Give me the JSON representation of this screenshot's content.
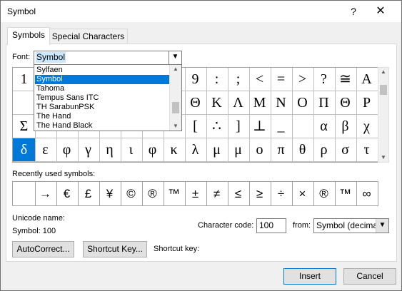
{
  "window": {
    "title": "Symbol",
    "help": "?",
    "close": "✕"
  },
  "tabs": [
    {
      "label": "Symbols"
    },
    {
      "label": "Special Characters"
    }
  ],
  "font": {
    "label": "Font:",
    "value": "Symbol",
    "dropdown_icon": "chevron-down-icon"
  },
  "font_list": [
    "Sylfaen",
    "Symbol",
    "Tahoma",
    "Tempus Sans ITC",
    "TH SarabunPSK",
    "The Hand",
    "The Hand Black"
  ],
  "grid": {
    "rows": [
      [
        "1",
        "",
        "",
        "",
        "",
        "",
        "",
        "",
        "9",
        ":",
        ";",
        "<",
        "=",
        ">",
        "?",
        "≅",
        "Α"
      ],
      [
        "",
        "",
        "",
        "",
        "",
        "",
        "",
        "",
        "Θ",
        "Κ",
        "Λ",
        "Μ",
        "Ν",
        "Ο",
        "Π",
        "Θ",
        "Ρ"
      ],
      [
        "Σ",
        "",
        "",
        "",
        "",
        "",
        "",
        "",
        "[",
        "∴",
        "]",
        "⊥",
        "_",
        "",
        "α",
        "β",
        "χ"
      ],
      [
        "δ",
        "ε",
        "φ",
        "γ",
        "η",
        "ι",
        "φ",
        "κ",
        "λ",
        "μ",
        "μ",
        "ο",
        "π",
        "θ",
        "ρ",
        "σ",
        "τ"
      ]
    ]
  },
  "recent": {
    "label": "Recently used symbols:",
    "symbols": [
      "",
      "→",
      "€",
      "£",
      "¥",
      "©",
      "®",
      "™",
      "±",
      "≠",
      "≤",
      "≥",
      "÷",
      "×",
      "®",
      "™",
      "∞"
    ]
  },
  "unicode": {
    "name_label": "Unicode name:",
    "name_value": "Symbol: 100"
  },
  "character_code": {
    "label": "Character code:",
    "value": "100",
    "from_label": "from:",
    "from_value": "Symbol (decimal)"
  },
  "buttons": {
    "autocorrect": "AutoCorrect...",
    "shortcut_key": "Shortcut Key...",
    "shortcut_key_label": "Shortcut key:",
    "insert": "Insert",
    "cancel": "Cancel"
  }
}
